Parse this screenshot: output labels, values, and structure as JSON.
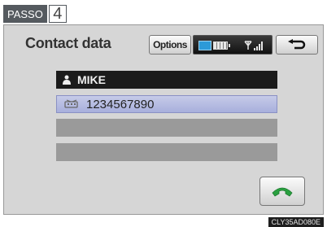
{
  "step": {
    "label": "PASSO",
    "number": "4"
  },
  "header": {
    "title": "Contact data",
    "options_label": "Options"
  },
  "contact": {
    "name": "MIKE",
    "phone": "1234567890"
  },
  "footer": {
    "code": "CLY35AD080E"
  },
  "icons": {
    "bluetooth": "bluetooth-icon",
    "battery": "battery-icon",
    "signal": "signal-strength-icon",
    "back": "back-arrow-icon",
    "person": "person-icon",
    "phone_type": "mobile-phone-icon",
    "call": "call-icon"
  },
  "colors": {
    "name_bg": "#1b1b1b",
    "selected_bg": "#b4bae2",
    "empty_bg": "#9a9a9a",
    "call_icon": "#2aa040"
  }
}
